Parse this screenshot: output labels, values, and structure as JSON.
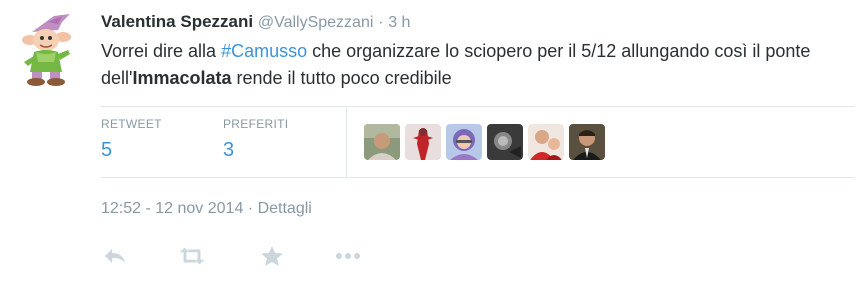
{
  "tweet": {
    "fullname": "Valentina Spezzani",
    "screen_name": "@VallySpezzani",
    "separator": "·",
    "time_ago": "3 h",
    "text_parts": {
      "p1": "Vorrei dire alla ",
      "hashtag": "#Camusso",
      "p2": " che organizzare lo sciopero per il 5/12 allungando così il ponte dell'",
      "bold": "Immacolata",
      "p3": " rende il tutto poco credibile"
    }
  },
  "stats": {
    "retweet_label": "RETWEET",
    "retweet_count": "5",
    "fav_label": "PREFERITI",
    "fav_count": "3"
  },
  "meta": {
    "timestamp": "12:52 - 12 nov 2014",
    "separator": "·",
    "details_link": "Dettagli"
  },
  "actions": {
    "icons": [
      "reply-icon",
      "retweet-icon",
      "favorite-icon",
      "more-icon"
    ]
  },
  "colors": {
    "link": "#3b94d9",
    "muted": "#8899a6",
    "border": "#e1e8ed",
    "icon": "#ccd6dd"
  }
}
